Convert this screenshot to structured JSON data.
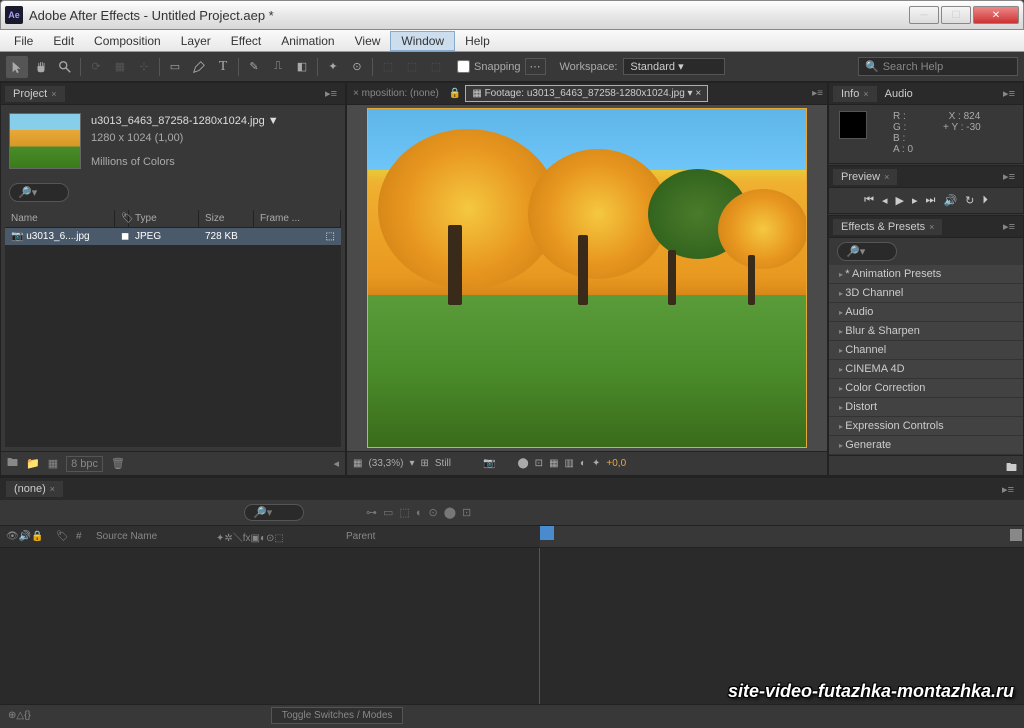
{
  "window": {
    "title": "Adobe After Effects - Untitled Project.aep *"
  },
  "menubar": [
    "File",
    "Edit",
    "Composition",
    "Layer",
    "Effect",
    "Animation",
    "View",
    "Window",
    "Help"
  ],
  "menubar_selected": "Window",
  "toolbar": {
    "snapping_label": "Snapping",
    "workspace_label": "Workspace:",
    "workspace_value": "Standard",
    "search_placeholder": "Search Help"
  },
  "project": {
    "tab": "Project",
    "filename": "u3013_6463_87258-1280x1024.jpg ▼",
    "dimensions": "1280 x 1024 (1,00)",
    "colors": "Millions of Colors",
    "columns": {
      "name": "Name",
      "type": "Type",
      "size": "Size",
      "frame": "Frame ..."
    },
    "row": {
      "name": "u3013_6....jpg",
      "type": "JPEG",
      "size": "728 KB"
    },
    "bpc": "8 bpc"
  },
  "viewer": {
    "tab_comp": "mposition: (none)",
    "tab_footage": "Footage: u3013_6463_87258-1280x1024.jpg",
    "zoom": "(33,3%)",
    "still": "Still",
    "exposure": "+0,0"
  },
  "info": {
    "tabs": [
      "Info",
      "Audio"
    ],
    "r": "R :",
    "g": "G :",
    "b": "B :",
    "a": "A :  0",
    "x": "X : 824",
    "y": "Y : -30"
  },
  "preview": {
    "tab": "Preview"
  },
  "effects": {
    "tab": "Effects & Presets",
    "items": [
      "* Animation Presets",
      "3D Channel",
      "Audio",
      "Blur & Sharpen",
      "Channel",
      "CINEMA 4D",
      "Color Correction",
      "Distort",
      "Expression Controls",
      "Generate"
    ]
  },
  "timeline": {
    "tab": "(none)",
    "col_layer": "#",
    "col_source": "Source Name",
    "col_parent": "Parent",
    "toggle": "Toggle Switches / Modes"
  },
  "watermark": "site-video-futazhka-montazhka.ru"
}
